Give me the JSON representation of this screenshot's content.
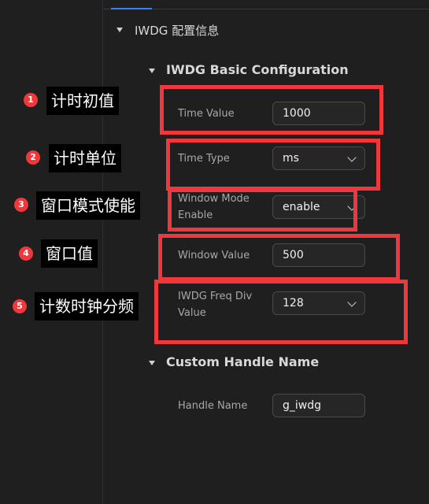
{
  "sections": {
    "root_title": "IWDG 配置信息",
    "basic_title": "IWDG Basic Configuration",
    "handle_title": "Custom Handle Name"
  },
  "fields": {
    "time_value": {
      "label": "Time Value",
      "value": "1000"
    },
    "time_type": {
      "label": "Time Type",
      "value": "ms"
    },
    "window_mode": {
      "label_line1": "Window Mode",
      "label_line2": "Enable",
      "value": "enable"
    },
    "window_value": {
      "label": "Window Value",
      "value": "500"
    },
    "freq_div": {
      "label_line1": "IWDG Freq Div",
      "label_line2": "Value",
      "value": "128"
    },
    "handle_name": {
      "label": "Handle Name",
      "value": "g_iwdg"
    }
  },
  "annotations": [
    {
      "num": "1",
      "text": "计时初值"
    },
    {
      "num": "2",
      "text": "计时单位"
    },
    {
      "num": "3",
      "text": "窗口模式使能"
    },
    {
      "num": "4",
      "text": "窗口值"
    },
    {
      "num": "5",
      "text": "计数时钟分频"
    }
  ],
  "colors": {
    "accent": "#3b82f6",
    "highlight": "#f0383c",
    "background": "#1f1f1f"
  }
}
